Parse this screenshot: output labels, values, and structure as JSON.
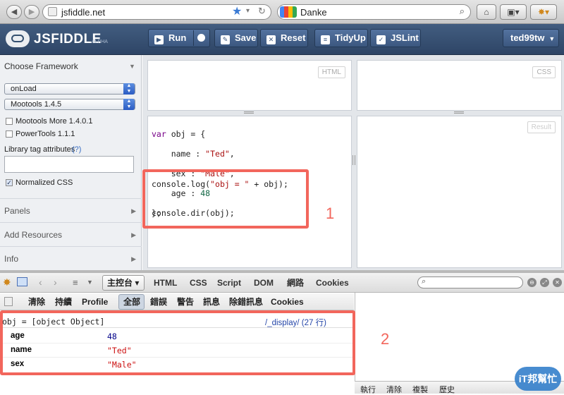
{
  "browser": {
    "url": "jsfiddle.net",
    "search_text": "Danke",
    "back": "◀",
    "forward": "▶"
  },
  "header": {
    "logo_text": "JSFIDDLE",
    "logo_badge": "ALPHA",
    "run_label": "Run",
    "save_label": "Save",
    "reset_label": "Reset",
    "tidyup_label": "TidyUp",
    "jslint_label": "JSLint",
    "user_label": "ted99tw"
  },
  "sidebar": {
    "framework_heading": "Choose Framework",
    "load_select": "onLoad",
    "framework_select": "Mootools 1.4.5",
    "check_more": "Mootools More 1.4.0.1",
    "check_power": "PowerTools 1.1.1",
    "lib_attr_label": "Library tag attributes",
    "lib_attr_help": "(?)",
    "normalized_css": "Normalized CSS",
    "panels": "Panels",
    "add_resources": "Add Resources",
    "info": "Info"
  },
  "panes": {
    "html_tag": "HTML",
    "css_tag": "CSS",
    "result_tag": "Result"
  },
  "code": {
    "l1_kw": "var",
    "l1_rest": " obj = {",
    "l2_a": "    name : ",
    "l2_s": "\"Ted\"",
    "l2_b": ",",
    "l3_a": "    sex : ",
    "l3_s": "\"Male\"",
    "l3_b": ",",
    "l4_a": "    age : ",
    "l4_n": "48",
    "l5": "};",
    "l6_a": "console.log(",
    "l6_s": "\"obj = \"",
    "l6_b": " + obj);",
    "l7": "console.dir(obj);"
  },
  "annotations": {
    "a1": "1",
    "a2": "2"
  },
  "firebug": {
    "console_tab": "主控台",
    "tabs": [
      "HTML",
      "CSS",
      "Script",
      "DOM",
      "網路",
      "Cookies"
    ],
    "sub_buttons": [
      "清除",
      "持續",
      "Profile",
      "全部",
      "錯誤",
      "警告",
      "訊息",
      "除錯訊息",
      "Cookies"
    ],
    "log_line": "obj = [object Object]",
    "log_source": "/_display/ (27 行)",
    "rows": [
      {
        "key": "age",
        "value": "48"
      },
      {
        "key": "name",
        "value": "\"Ted\""
      },
      {
        "key": "sex",
        "value": "\"Male\""
      }
    ],
    "bottom_tabs": [
      "執行",
      "清除",
      "複製",
      "歷史"
    ]
  },
  "watermark": "iT邦幫忙",
  "colors": {
    "header_bg": "#34506f",
    "annotation": "#f2665c",
    "string": "#aa1111",
    "number": "#116644",
    "keyword": "#770088"
  }
}
